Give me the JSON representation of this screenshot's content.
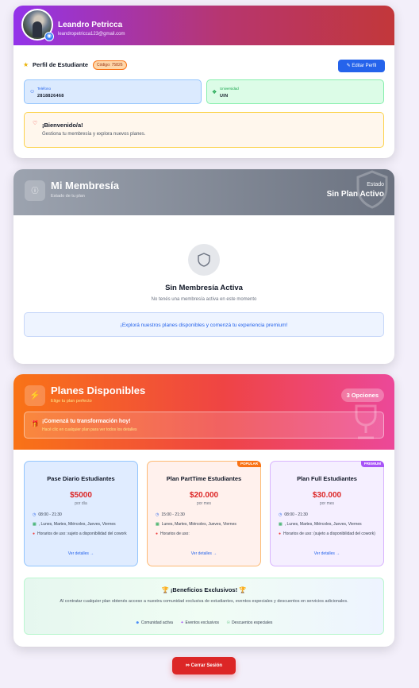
{
  "profile": {
    "name": "Leandro Petricca",
    "email": "leandropetricca123@gmail.com",
    "section_title": "Perfil de Estudiante",
    "code_badge": "Código: 75826",
    "edit_label": "Editar Perfil",
    "phone_label": "Teléfono",
    "phone_value": "2818826468",
    "university_label": "Universidad",
    "university_value": "UIN",
    "welcome_title": "¡Bienvenido/a!",
    "welcome_text": "Gestiona tu membresía y explora nuevos planes."
  },
  "membership": {
    "title": "Mi Membresía",
    "subtitle": "Estado de tu plan",
    "status_label": "Estado",
    "status_value": "Sin Plan Activo",
    "empty_title": "Sin Membresía Activa",
    "empty_text": "No tenés una membresía activa en este momento",
    "explore_text": "¡Explorá nuestros planes disponibles y comenzá tu experiencia premium!"
  },
  "plans": {
    "title": "Planes Disponibles",
    "subtitle": "Elige tu plan perfecto",
    "count_badge": "3 Opciones",
    "cta_title": "¡Comenzá tu transformación hoy!",
    "cta_text": "Hacé clic en cualquier plan para ver todos los detalles",
    "items": [
      {
        "name": "Pase Diario Estudiantes",
        "price": "$5000",
        "period": "por día",
        "hours": "08:00 - 21:30",
        "days": ", Lunes, Martes, Miércoles, Jueves, Viernes",
        "note": "Horarios de uso: sujeto a disponibilidad del cowork",
        "details": "Ver detalles →"
      },
      {
        "name": "Plan PartTime Estudiantes",
        "price": "$20.000",
        "period": "por mes",
        "hours": "15:00 - 21:30",
        "days": "Lunes, Martes, Miércoles, Jueves, Viernes",
        "note": "Horarios de uso:",
        "details": "Ver detalles →",
        "ribbon": "POPULAR"
      },
      {
        "name": "Plan Full Estudiantes",
        "price": "$30.000",
        "period": "por mes",
        "hours": "08:00 - 21:30",
        "days": ", Lunes, Martes, Miércoles, Jueves, Viernes",
        "note": "Horarios de uso: (sujeto a disponibilidad del cowork)",
        "details": "Ver detalles →",
        "ribbon": "PREMIUM"
      }
    ],
    "benefits_title": "¡Beneficios Exclusivos!",
    "benefits_text": "Al contratar cualquier plan obtenés acceso a nuestra comunidad exclusiva de estudiantes, eventos especiales y descuentos en servicios adicionales.",
    "tags": [
      "Comunidad activa",
      "Eventos exclusivos",
      "Descuentos especiales"
    ]
  },
  "logout_label": "Cerrar Sesión",
  "colors": {
    "brand_purple": "#9333ea",
    "primary_blue": "#2563eb",
    "danger_red": "#dc2626",
    "orange": "#f97316"
  }
}
